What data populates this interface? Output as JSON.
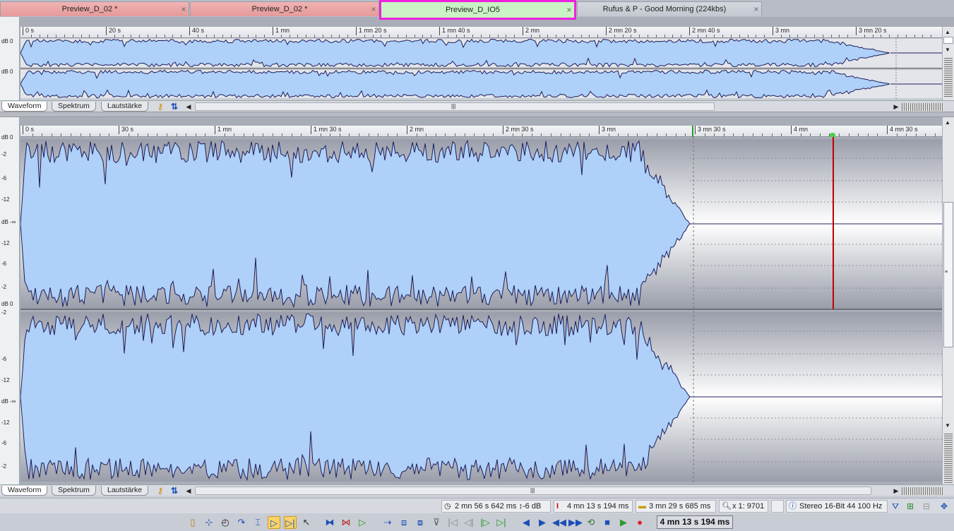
{
  "tabs": [
    {
      "label": "Preview_D_02 *",
      "close": "×",
      "style": "red"
    },
    {
      "label": "Preview_D_02 *",
      "close": "×",
      "style": "red"
    },
    {
      "label": "Preview_D_IO5",
      "close": "×",
      "style": "active"
    },
    {
      "label": "Rufus & P - Good Morning (224kbs)",
      "close": "×",
      "style": "gray"
    }
  ],
  "overview": {
    "ticks": [
      "0 s",
      "20 s",
      "40 s",
      "1 mn",
      "1 mn 20 s",
      "1 mn 40 s",
      "2 mn",
      "2 mn 20 s",
      "2 mn 40 s",
      "3 mn",
      "3 mn 20 s"
    ],
    "db_labels": [
      "dB 0",
      "dB 0"
    ]
  },
  "main": {
    "ticks": [
      "0 s",
      "30 s",
      "1 mn",
      "1 mn 30 s",
      "2 mn",
      "2 mn 30 s",
      "3 mn",
      "3 mn 30 s",
      "4 mn",
      "4 mn 30 s"
    ],
    "db_top": [
      "dB 0",
      "-2",
      "-6",
      "-12",
      "dB -∞",
      "-12",
      "-6",
      "-2",
      "dB 0"
    ],
    "db_bottom": [
      "-2",
      "-6",
      "-12",
      "dB -∞",
      "-12",
      "-6",
      "-2"
    ]
  },
  "view_tabs": [
    "Waveform",
    "Spektrum",
    "Lautstärke"
  ],
  "status": {
    "selection": "2 mn 56 s 642 ms",
    "gain": "-6 dB",
    "cursor": "4 mn 13 s 194 ms",
    "length": "3 mn 29 s 685 ms",
    "zoom": "x 1: 9701",
    "format": "Stereo 16-Bit 44 100 Hz"
  },
  "toolbar": {
    "time": "4 mn 13 s 194 ms"
  },
  "colors": {
    "wave_fill": "#aed0f9",
    "wave_line": "#1d1d5a",
    "cursor": "#c00000",
    "active_tab_border": "#ee22dd",
    "active_tab_bg": "#c9f3c4"
  }
}
